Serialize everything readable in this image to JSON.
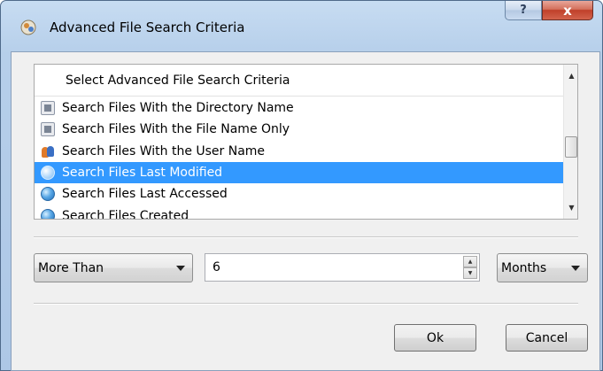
{
  "window": {
    "title": "Advanced File Search Criteria",
    "help_label": "?",
    "close_label": "x"
  },
  "list": {
    "header": "Select Advanced File Search Criteria",
    "items": [
      {
        "label": "Search Files With the Directory Name",
        "icon": "document-icon",
        "selected": false
      },
      {
        "label": "Search Files With the File Name Only",
        "icon": "document-icon",
        "selected": false
      },
      {
        "label": "Search Files With the User Name",
        "icon": "users-icon",
        "selected": false
      },
      {
        "label": "Search Files Last Modified",
        "icon": "globe-icon",
        "selected": true
      },
      {
        "label": "Search Files Last Accessed",
        "icon": "globe-icon",
        "selected": false
      },
      {
        "label": "Search Files Created",
        "icon": "globe-icon",
        "selected": false
      }
    ]
  },
  "criteria": {
    "comparison": "More Than",
    "amount": "6",
    "unit": "Months"
  },
  "buttons": {
    "ok": "Ok",
    "cancel": "Cancel"
  },
  "colors": {
    "selection": "#3399ff",
    "frame": "#b6cfea",
    "close_button": "#c0402a"
  }
}
